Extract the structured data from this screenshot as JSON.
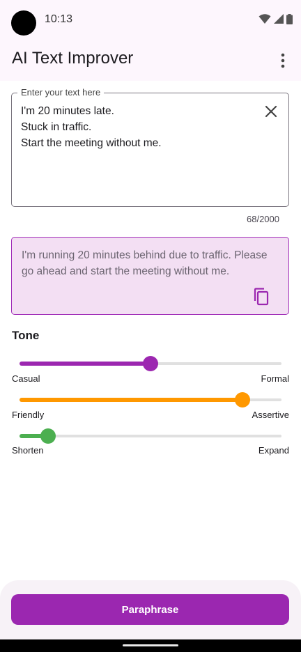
{
  "status": {
    "time": "10:13"
  },
  "app": {
    "title": "AI Text Improver"
  },
  "input": {
    "label": "Enter your text here",
    "value": "I'm 20 minutes late.\nStuck in traffic.\nStart the meeting without me.",
    "counter": "68/2000"
  },
  "result": {
    "text": "I'm running 20 minutes behind due to traffic. Please go ahead and start the meeting without me."
  },
  "tone": {
    "title": "Tone",
    "sliders": [
      {
        "left": "Casual",
        "right": "Formal",
        "value": 0.5,
        "color": "#9c27b0"
      },
      {
        "left": "Friendly",
        "right": "Assertive",
        "value": 0.85,
        "color": "#ff9800"
      },
      {
        "left": "Shorten",
        "right": "Expand",
        "value": 0.11,
        "color": "#4caf50"
      }
    ]
  },
  "actions": {
    "paraphrase_label": "Paraphrase"
  },
  "colors": {
    "accent": "#9b27b0",
    "result_bg": "#f3dff3"
  },
  "icons": [
    "wifi-icon",
    "signal-icon",
    "battery-icon",
    "more-vert-icon",
    "close-icon",
    "copy-icon"
  ]
}
